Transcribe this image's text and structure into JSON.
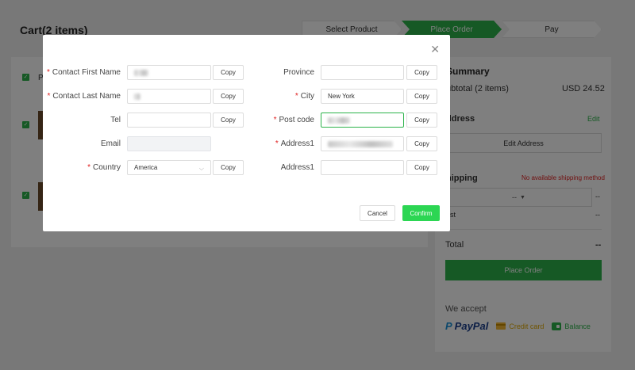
{
  "cart": {
    "title": "Cart(2 items)"
  },
  "steps": [
    "Select Product",
    "Place Order",
    "Pay"
  ],
  "left": {
    "product_label": "P"
  },
  "summary": {
    "title": "Summary",
    "subtotal_label": "ubtotal (2 items)",
    "subtotal_value": "USD 24.52",
    "address_title": "ddress",
    "edit_link": "Edit",
    "edit_address_button": "Edit Address",
    "shipping_title": "hipping",
    "no_shipping": "No available shipping method",
    "shipping_select": "--",
    "shipping_value": "--",
    "cost_label": "ost",
    "cost_value": "--",
    "total_label": "Total",
    "total_value": "--",
    "place_order_button": "Place Order",
    "we_accept": "We accept",
    "payments": {
      "paypal": "PayPal",
      "credit_card": "Credit card",
      "balance": "Balance"
    }
  },
  "modal": {
    "fields_left": {
      "first_name": {
        "label": "Contact First Name",
        "required": "*"
      },
      "last_name": {
        "label": "Contact Last Name",
        "required": "*"
      },
      "tel": {
        "label": "Tel"
      },
      "email": {
        "label": "Email"
      },
      "country": {
        "label": "Country",
        "required": "*",
        "value": "America"
      }
    },
    "fields_right": {
      "province": {
        "label": "Province"
      },
      "city": {
        "label": "City",
        "required": "*",
        "value": "New York"
      },
      "post_code": {
        "label": "Post code",
        "required": "*"
      },
      "address1": {
        "label": "Address1",
        "required": "*"
      },
      "address1b": {
        "label": "Address1"
      }
    },
    "copy_label": "Copy",
    "cancel_button": "Cancel",
    "confirm_button": "Confirm",
    "close_icon": "close-icon"
  }
}
